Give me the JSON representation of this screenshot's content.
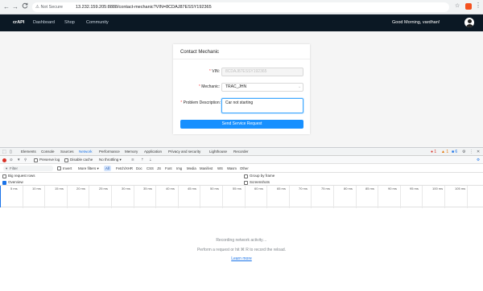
{
  "browser": {
    "back": "←",
    "forward": "→",
    "reload": "C",
    "security_label": "Not Secure",
    "url": "13.232.159.205:8888/contact-mechanic?VIN=8CDAJ87ESSY192365",
    "star": "☆",
    "menu": "⋮"
  },
  "app_nav": {
    "brand": "crAPI",
    "links": [
      "Dashboard",
      "Shop",
      "Community"
    ],
    "greeting": "Good Morning, vardhan!"
  },
  "form": {
    "title": "Contact Mechanic",
    "vin_label": "VIN:",
    "vin_value": "8CDAJ87ESSY192365",
    "mechanic_label": "Mechanic:",
    "mechanic_value": "TRAC_JHN",
    "problem_label": "Problem Description:",
    "problem_value": "Car not starting",
    "submit_label": "Send Service Request"
  },
  "devtools": {
    "tabs": [
      "Elements",
      "Console",
      "Sources",
      "Network",
      "Performance",
      "Memory",
      "Application",
      "Privacy and security",
      "Lighthouse",
      "Recorder"
    ],
    "errors": "1",
    "warnings": "1",
    "infos": "6",
    "toolbar": {
      "preserve_log": "Preserve log",
      "disable_cache": "Disable cache",
      "throttling": "No throttling"
    },
    "filter": {
      "placeholder": "Filter",
      "invert": "Invert",
      "more_filters": "More filters ▾",
      "chips": [
        "All",
        "Fetch/XHR",
        "Doc",
        "CSS",
        "JS",
        "Font",
        "Img",
        "Media",
        "Manifest",
        "WS",
        "Wasm",
        "Other"
      ]
    },
    "options": {
      "big_rows": "Big request rows",
      "overview": "Overview",
      "group_by_frame": "Group by frame",
      "screenshots": "Screenshots"
    },
    "timeline_ticks": [
      "5 ms",
      "10 ms",
      "15 ms",
      "20 ms",
      "25 ms",
      "30 ms",
      "35 ms",
      "40 ms",
      "45 ms",
      "50 ms",
      "55 ms",
      "60 ms",
      "65 ms",
      "70 ms",
      "75 ms",
      "80 ms",
      "85 ms",
      "90 ms",
      "95 ms",
      "100 ms",
      "105 ms"
    ],
    "empty": {
      "line1": "Recording network activity…",
      "line2": "Perform a request or hit ⌘ R to record the reload.",
      "link": "Learn more"
    }
  }
}
